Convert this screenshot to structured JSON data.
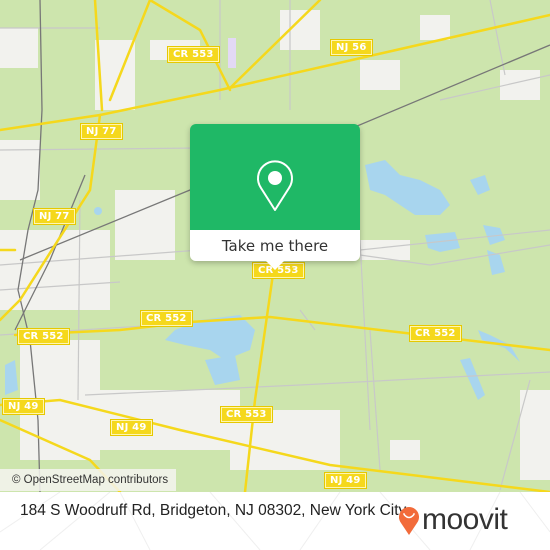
{
  "map": {
    "attribution": "© OpenStreetMap contributors",
    "colors": {
      "land": "#cde5ad",
      "urban": "#f2f2ee",
      "water": "#a8d5ee",
      "major_road": "#f5d81c",
      "minor_road": "#c8c8c8",
      "railway": "#777777",
      "shield_bg": "#f5d81c"
    },
    "road_labels": [
      {
        "id": "cr553-north",
        "text": "CR 553"
      },
      {
        "id": "nj56",
        "text": "NJ 56"
      },
      {
        "id": "nj77-north",
        "text": "NJ 77"
      },
      {
        "id": "nj77-south",
        "text": "NJ 77"
      },
      {
        "id": "cr553-center",
        "text": "CR 553"
      },
      {
        "id": "cr552-west",
        "text": "CR 552"
      },
      {
        "id": "cr552-center",
        "text": "CR 552"
      },
      {
        "id": "cr552-east",
        "text": "CR 552"
      },
      {
        "id": "nj49-west",
        "text": "NJ 49"
      },
      {
        "id": "nj49-center",
        "text": "NJ 49"
      },
      {
        "id": "cr553-south",
        "text": "CR 553"
      },
      {
        "id": "nj49-south",
        "text": "NJ 49"
      }
    ]
  },
  "popup": {
    "icon": "map-pin-icon",
    "button_label": "Take me there",
    "color": "#1fb866"
  },
  "footer": {
    "address": "184 S Woodruff Rd, Bridgeton, NJ 08302, New York City",
    "logo_text": "moovit",
    "logo_icon": "moovit-pin-icon",
    "logo_color": "#f26b3a"
  }
}
